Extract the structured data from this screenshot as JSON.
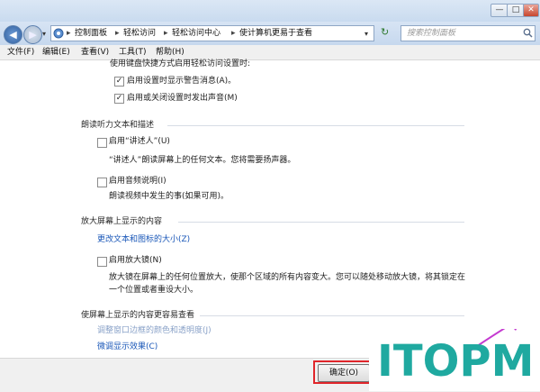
{
  "window": {
    "min_glyph": "—",
    "max_glyph": "□",
    "close_glyph": "✕"
  },
  "address": {
    "crumbs": [
      "控制面板",
      "轻松访问",
      "轻松访问中心",
      "使计算机更易于查看"
    ],
    "separator": "▸",
    "refresh_glyph": "↻",
    "dropdown_glyph": "▾",
    "back_glyph": "◀",
    "forward_glyph": "▶"
  },
  "search": {
    "placeholder": "搜索控制面板",
    "icon": "magnifier-icon"
  },
  "menu": {
    "file": "文件(F)",
    "edit": "编辑(E)",
    "view": "查看(V)",
    "tools": "工具(T)",
    "help": "帮助(H)"
  },
  "content": {
    "shortcut_intro": "使用键盘快捷方式启用轻松访问设置时:",
    "warn_option": "启用设置时显示警告消息(A)。",
    "warn_checked": true,
    "sound_option": "启用或关闭设置时发出声音(M)",
    "sound_checked": true,
    "section_narrator": "朗读听力文本和描述",
    "narrator_option": "启用“讲述人”(U)",
    "narrator_desc": "“讲述人”朗读屏幕上的任何文本。您将需要扬声器。",
    "audio_option": "启用音频说明(I)",
    "audio_desc": "朗读视频中发生的事(如果可用)。",
    "section_magnify": "放大屏幕上显示的内容",
    "text_size_link": "更改文本和图标的大小(Z)",
    "magnifier_option": "启用放大镜(N)",
    "magnifier_desc_1": "放大镜在屏幕上的任何位置放大，使那个区域的所有内容变大。您可以随处移动放大镜，将其锁定在",
    "magnifier_desc_2": "一个位置或者重设大小。",
    "section_easy": "使屏幕上显示的内容更容易查看",
    "window_color_link": "调整窗口边框的颜色和透明度(J)",
    "fine_tune_link": "微调显示效果(C)"
  },
  "footer": {
    "ok_label": "确定(O)"
  },
  "watermark": {
    "text": "ITOPM",
    "color": "#1fa9a0",
    "accent": "#c43ad0"
  },
  "colors": {
    "link": "#1a57b8",
    "highlight_border": "#e0262b"
  }
}
